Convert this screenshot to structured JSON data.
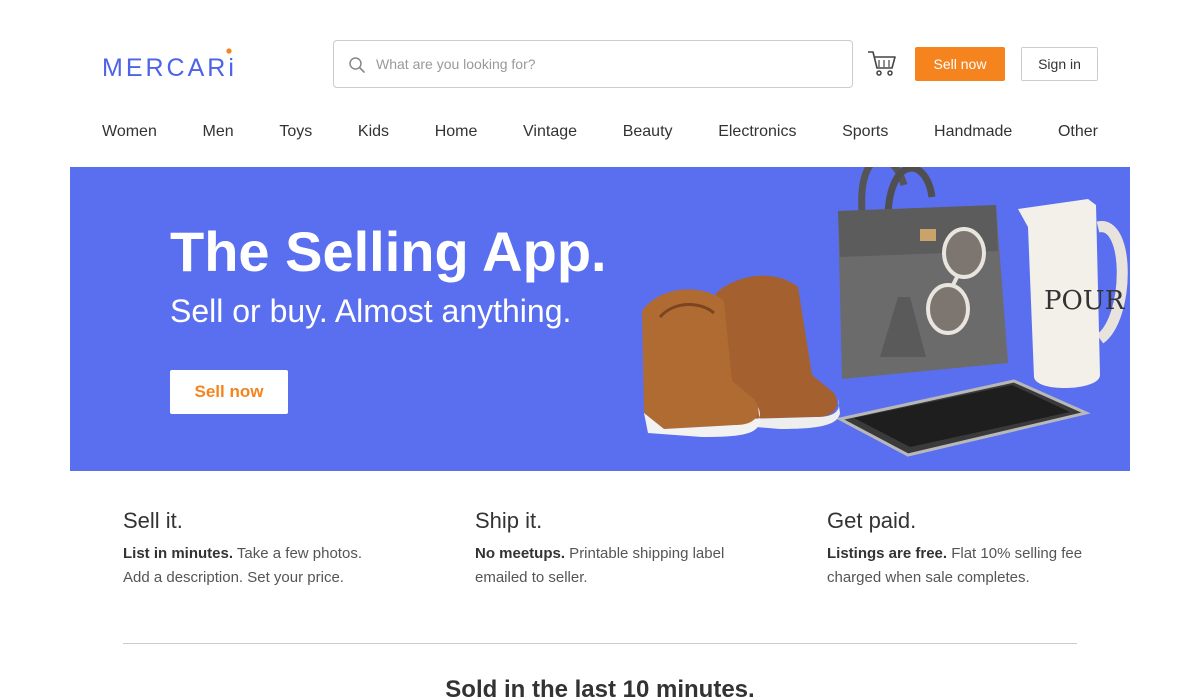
{
  "header": {
    "logo_text": "MERCARi",
    "search_placeholder": "What are you looking for?",
    "cart_icon": "cart-icon",
    "sell_label": "Sell now",
    "signin_label": "Sign in"
  },
  "nav": {
    "categories": [
      "Women",
      "Men",
      "Toys",
      "Kids",
      "Home",
      "Vintage",
      "Beauty",
      "Electronics",
      "Sports",
      "Handmade",
      "Other"
    ]
  },
  "hero": {
    "title": "The Selling App.",
    "subtitle": "Sell or buy. Almost anything.",
    "button_label": "Sell now",
    "pitcher_text": "POUR"
  },
  "features": [
    {
      "title": "Sell it.",
      "bold": "List in minutes.",
      "text": " Take a few photos. Add a description. Set your price."
    },
    {
      "title": "Ship it.",
      "bold": "No meetups.",
      "text": " Printable shipping label emailed to seller."
    },
    {
      "title": "Get paid.",
      "bold": "Listings are free.",
      "text": " Flat 10% selling fee charged when sale completes."
    }
  ],
  "sold_section": {
    "title": "Sold in the last 10 minutes."
  },
  "colors": {
    "brand_blue": "#4d63e8",
    "hero_bg": "#5a6ff0",
    "accent_orange": "#f5841f"
  }
}
